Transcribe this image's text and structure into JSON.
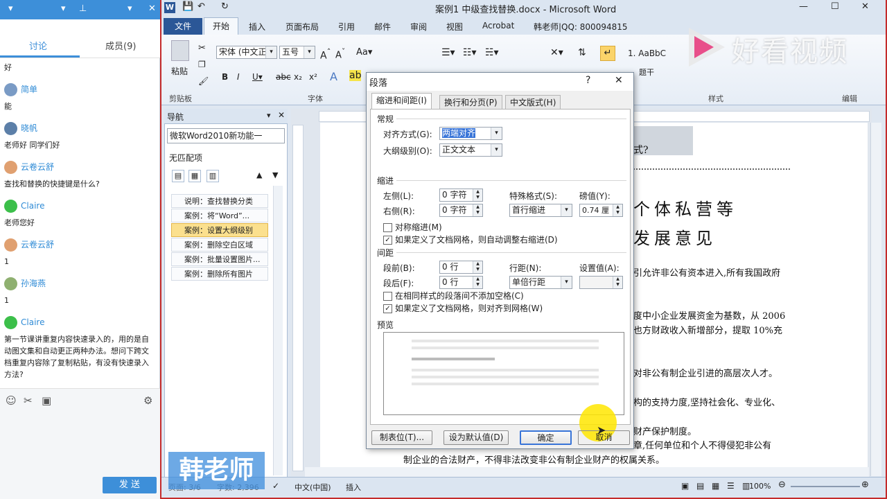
{
  "chat": {
    "tabs": [
      "讨论",
      "成员(9)"
    ],
    "messages": [
      {
        "text": "好"
      },
      {
        "nick": "简单",
        "text": "能"
      },
      {
        "nick": "晓帆",
        "text": "老师好 同学们好"
      },
      {
        "nick": "云卷云舒",
        "text": "查找和替换的快捷键是什么?"
      },
      {
        "nick": "Claire",
        "text": "老师您好"
      },
      {
        "nick": "云卷云舒",
        "text": "1"
      },
      {
        "nick": "孙海燕",
        "text": "1"
      },
      {
        "nick": "Claire",
        "text": "第一节课讲重复内容快速录入的，用的是自动图文集和自动更正两种办法。想问下跨文档重复内容除了复制粘贴，有没有快速录入方法?"
      }
    ],
    "send_label": "发 送"
  },
  "word": {
    "title": "案例1 中级查找替换.docx - Microsoft Word",
    "tabs": [
      "文件",
      "开始",
      "插入",
      "页面布局",
      "引用",
      "邮件",
      "审阅",
      "视图",
      "Acrobat",
      "韩老师|QQ: 800094815"
    ],
    "font_name": "宋体 (中文正)",
    "font_size": "五号",
    "paste_label": "粘贴",
    "groups": [
      "剪贴板",
      "字体",
      "样式",
      "编辑"
    ],
    "style_sample": "1. AaBbC",
    "style_heading": "题干",
    "nav": {
      "title": "导航",
      "search_value": "微软Word2010新功能一",
      "no_match": "无匹配项",
      "items": [
        "说明：查找替换分类",
        "案例：将“Word”...",
        "案例：设置大纲级别",
        "案例：删除空白区域",
        "案例：批量设置图片...",
        "案例：删除所有图片"
      ],
      "selected_index": 2
    },
    "doc_lines": [
      "式?",
      "个体私营等",
      "发展意见",
      "引允许非公有资本进入,所有我国政府",
      "度中小企业发展资金为基数，从 2006",
      "也方财政收入新增部分，提取 10%充",
      "对非公有制企业引进的高层次人才。",
      "构的支持力度,坚持社会化、专业化、",
      "财产保护制度。",
      "章,任何单位和个人不得侵犯非公有",
      "制企业的合法财产，不得非法改变非公有制企业财产的权属关系。"
    ],
    "status": {
      "page": "页面: 3/6",
      "words": "字数: 2,396",
      "lang": "中文(中国)",
      "mode": "插入",
      "zoom": "100%"
    }
  },
  "dialog": {
    "title": "段落",
    "tabs": [
      "缩进和间距(I)",
      "换行和分页(P)",
      "中文版式(H)"
    ],
    "general": "常规",
    "align_label": "对齐方式(G):",
    "align_value": "两端对齐",
    "outline_label": "大纲级别(O):",
    "outline_value": "正文文本",
    "indent": "缩进",
    "left_label": "左侧(L):",
    "left_value": "0 字符",
    "right_label": "右侧(R):",
    "right_value": "0 字符",
    "special_label": "特殊格式(S):",
    "special_value": "首行缩进",
    "by_label": "磅值(Y):",
    "by_value": "0.74 厘",
    "mirror_label": "对称缩进(M)",
    "grid_indent_label": "如果定义了文档网格，则自动调整右缩进(D)",
    "spacing": "间距",
    "before_label": "段前(B):",
    "before_value": "0 行",
    "after_label": "段后(F):",
    "after_value": "0 行",
    "line_label": "行距(N):",
    "line_value": "单倍行距",
    "at_label": "设置值(A):",
    "no_space_label": "在相同样式的段落间不添加空格(C)",
    "snap_grid_label": "如果定义了文档网格，则对齐到网格(W)",
    "preview": "预览",
    "btn_tabs": "制表位(T)...",
    "btn_default": "设为默认值(D)",
    "btn_ok": "确定",
    "btn_cancel": "取消",
    "help": "?",
    "close": "✕"
  },
  "watermark": {
    "brand": "好看视频",
    "teacher": "韩老师"
  },
  "colors": {
    "accent": "#3d8fd9",
    "word_blue": "#2b5797",
    "selection": "#fbe08e",
    "frame": "#c42b2b"
  }
}
